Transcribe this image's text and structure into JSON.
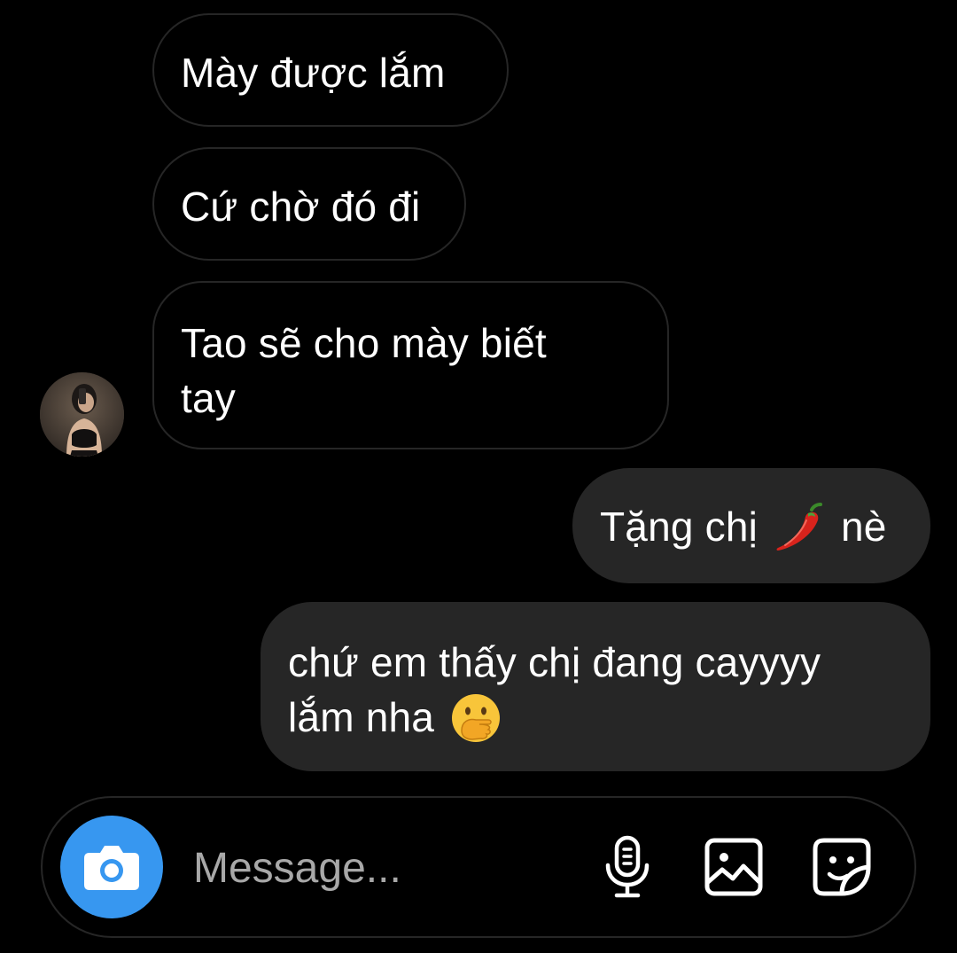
{
  "messages": [
    {
      "direction": "incoming",
      "text": "Mày được lắm"
    },
    {
      "direction": "incoming",
      "text": "Cứ chờ đó đi"
    },
    {
      "direction": "incoming",
      "text_line1": "Tao sẽ cho mày biết",
      "text_line2": "tay"
    },
    {
      "direction": "outgoing",
      "text_before": "Tặng chị",
      "emoji": "chili-pepper",
      "text_after": "nè"
    },
    {
      "direction": "outgoing",
      "text_line1": "chứ em thấy chị đang cayyyy",
      "text_line2": "lắm nha",
      "emoji": "face-with-hand-over-mouth"
    }
  ],
  "composer": {
    "placeholder": "Message...",
    "icons": [
      "camera-icon",
      "microphone-icon",
      "gallery-icon",
      "sticker-icon"
    ]
  },
  "colors": {
    "background": "#000000",
    "outgoing_bubble": "#262626",
    "incoming_border": "#262626",
    "camera_button": "#3797f0",
    "placeholder": "#a8a8a8"
  }
}
